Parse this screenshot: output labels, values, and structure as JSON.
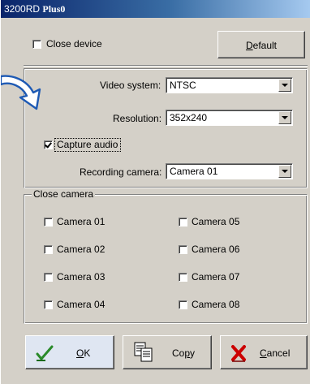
{
  "window": {
    "title_prefix": "3200RD",
    "title_bold": "Plus0"
  },
  "top": {
    "close_device_label": "Close device",
    "close_device_checked": false,
    "default_button": "Default"
  },
  "video": {
    "video_system_label": "Video system:",
    "video_system_value": "NTSC",
    "resolution_label": "Resolution:",
    "resolution_value": "352x240",
    "capture_audio_label": "Capture audio",
    "capture_audio_checked": true,
    "recording_camera_label": "Recording camera:",
    "recording_camera_value": "Camera 01"
  },
  "close_camera": {
    "group_label": "Close camera",
    "cameras": [
      {
        "label": "Camera 01",
        "checked": false
      },
      {
        "label": "Camera 02",
        "checked": false
      },
      {
        "label": "Camera 03",
        "checked": false
      },
      {
        "label": "Camera 04",
        "checked": false
      },
      {
        "label": "Camera 05",
        "checked": false
      },
      {
        "label": "Camera 06",
        "checked": false
      },
      {
        "label": "Camera 07",
        "checked": false
      },
      {
        "label": "Camera 08",
        "checked": false
      }
    ]
  },
  "buttons": {
    "ok": "OK",
    "copy": "Copy",
    "cancel": "Cancel"
  },
  "icons": {
    "callout": "curved-arrow-icon",
    "ok": "checkmark-icon",
    "copy": "copy-icon",
    "cancel": "x-icon"
  },
  "colors": {
    "title_start": "#0a246a",
    "title_end": "#a6caf0",
    "face": "#d4d0c8",
    "cancel_red": "#cc0000",
    "ok_green": "#2a8a2a",
    "callout_blue": "#1e5ab4"
  }
}
